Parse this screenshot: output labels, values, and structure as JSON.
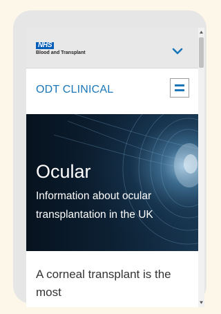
{
  "nhs": {
    "logo_text": "NHS",
    "org_name": "Blood and Transplant",
    "chevron_icon": "chevron-down-icon"
  },
  "header": {
    "site_title": "ODT CLINICAL",
    "menu_icon": "hamburger-menu-icon"
  },
  "hero": {
    "title": "Ocular",
    "subtitle": "Information about ocular transplantation in the UK"
  },
  "main": {
    "intro_text": "A corneal transplant is the most"
  },
  "colors": {
    "nhs_blue": "#005eb8",
    "accent_blue": "#1976b8",
    "hero_bg": "#0b1b2c"
  }
}
